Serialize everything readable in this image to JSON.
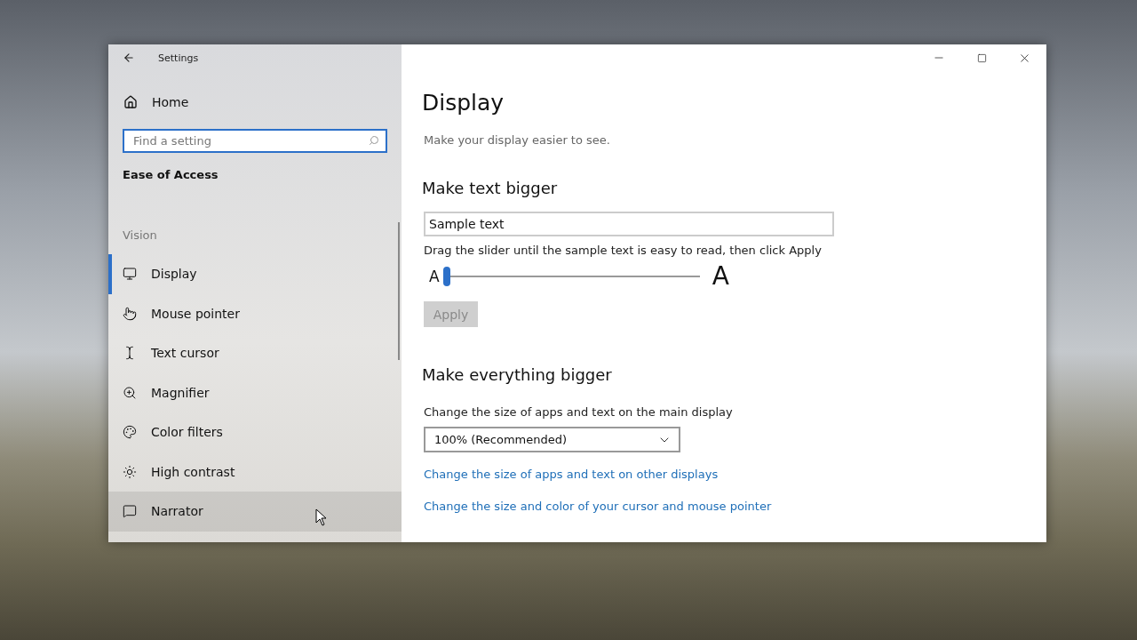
{
  "window": {
    "title": "Settings"
  },
  "sidebar": {
    "home": "Home",
    "search": {
      "placeholder": "Find a setting"
    },
    "section": "Ease of Access",
    "group": "Vision",
    "items": [
      {
        "label": "Display",
        "kind": "display",
        "selected": true,
        "hovered": false
      },
      {
        "label": "Mouse pointer",
        "kind": "pointer",
        "selected": false,
        "hovered": false
      },
      {
        "label": "Text cursor",
        "kind": "cursor",
        "selected": false,
        "hovered": false
      },
      {
        "label": "Magnifier",
        "kind": "magnifier",
        "selected": false,
        "hovered": false
      },
      {
        "label": "Color filters",
        "kind": "palette",
        "selected": false,
        "hovered": false
      },
      {
        "label": "High contrast",
        "kind": "contrast",
        "selected": false,
        "hovered": false
      },
      {
        "label": "Narrator",
        "kind": "narrator",
        "selected": false,
        "hovered": true
      }
    ]
  },
  "main": {
    "title": "Display",
    "subtitle": "Make your display easier to see.",
    "text_section": {
      "heading": "Make text bigger",
      "sample": {
        "value": "Sample text"
      },
      "hint": "Drag the slider until the sample text is easy to read, then click Apply",
      "slider": {
        "min_label": "A",
        "max_label": "A",
        "level": 0
      },
      "apply": {
        "label": "Apply",
        "disabled": true
      }
    },
    "scale_section": {
      "heading": "Make everything bigger",
      "label": "Change the size of apps and text on the main display",
      "dropdown": {
        "value": "100% (Recommended)"
      },
      "links": [
        "Change the size of apps and text on other displays",
        "Change the size and color of your cursor and mouse pointer"
      ]
    }
  }
}
